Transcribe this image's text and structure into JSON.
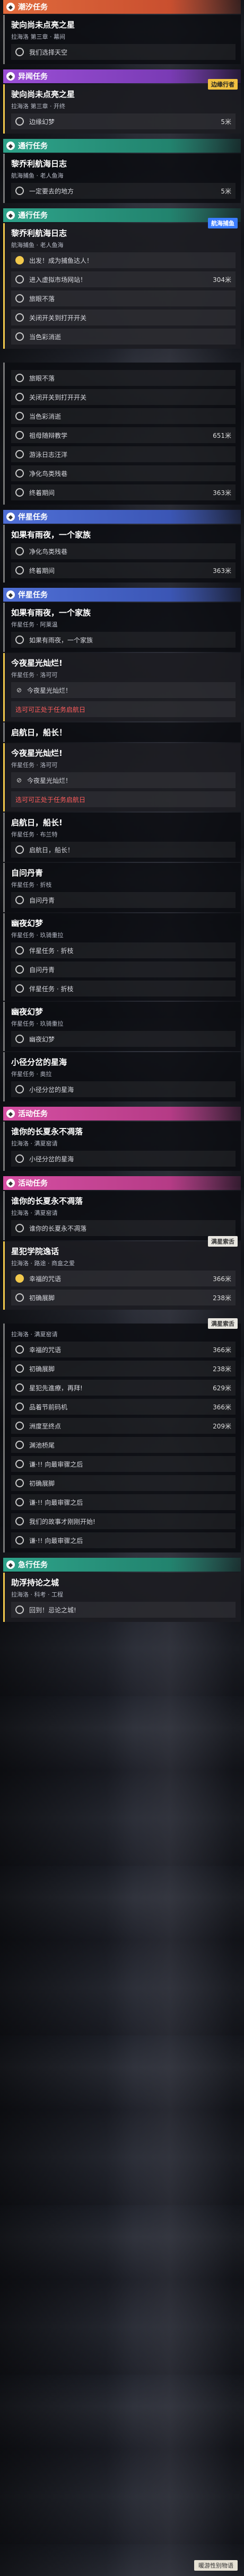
{
  "groups": [
    {
      "header": "潮汐任务",
      "color": "orange",
      "quests": [
        {
          "title": "驶向尚未点亮之星",
          "subtitle": "拉海洛 第三章 · 幕间",
          "active": false,
          "steps": [
            {
              "label": "我们选择天空",
              "distance": "",
              "done": false
            }
          ]
        }
      ]
    },
    {
      "header": "异闻任务",
      "color": "purple",
      "quests": [
        {
          "title": "驶向尚未点亮之星",
          "subtitle": "拉海洛 第三章 · 开终",
          "badge": "边缘行者",
          "active": true,
          "steps": [
            {
              "label": "边缘幻梦",
              "distance": "5米",
              "done": false
            }
          ]
        }
      ]
    },
    {
      "header": "通行任务",
      "color": "teal",
      "quests": [
        {
          "title": "黎乔利航海日志",
          "subtitle": "航海捕鱼 · 老人鱼海",
          "active": false,
          "steps": [
            {
              "label": "一定要去的地方",
              "distance": "5米",
              "done": false
            }
          ]
        }
      ]
    },
    {
      "header": "通行任务",
      "color": "teal",
      "quests": [
        {
          "title": "黎乔利航海日志",
          "subtitle": "航海捕鱼 · 老人鱼海",
          "badge": "航海捕鱼",
          "badgeStyle": "blue",
          "active": true,
          "steps": [
            {
              "label": "出发！成为捕鱼达人！",
              "distance": "",
              "done": true
            },
            {
              "label": "进入虚拟市场网站！",
              "distance": "304米",
              "done": false
            },
            {
              "label": "旅眼不落",
              "distance": "",
              "done": false
            },
            {
              "label": "关闭开关到打开开关",
              "distance": "",
              "done": false
            },
            {
              "label": "当色彩消逝",
              "distance": "",
              "done": false
            }
          ]
        }
      ]
    },
    {
      "header": "",
      "color": "",
      "quests": [
        {
          "title": "",
          "subtitle": "",
          "active": false,
          "steps": [
            {
              "label": "旅眼不落",
              "distance": "",
              "done": false
            },
            {
              "label": "关闭开关到打开开关",
              "distance": "",
              "done": false
            },
            {
              "label": "当色彩消逝",
              "distance": "",
              "done": false
            },
            {
              "label": "祖母随辩教学",
              "distance": "651米",
              "done": false
            },
            {
              "label": "游泳日志汪洋",
              "distance": "",
              "done": false
            },
            {
              "label": "净化鸟类残巷",
              "distance": "",
              "done": false
            },
            {
              "label": "终着期间",
              "distance": "363米",
              "done": false
            }
          ]
        }
      ]
    },
    {
      "header": "伴星任务",
      "color": "blue",
      "quests": [
        {
          "title": "如果有雨夜，一个家族",
          "subtitle": "",
          "active": false,
          "steps": [
            {
              "label": "净化鸟类残巷",
              "distance": "",
              "done": false
            },
            {
              "label": "终着期间",
              "distance": "363米",
              "done": false
            }
          ]
        }
      ]
    },
    {
      "header": "伴星任务",
      "color": "blue",
      "quests": [
        {
          "title": "如果有雨夜，一个家族",
          "subtitle": "伴星任务 · 阿莱温",
          "active": false,
          "steps": [
            {
              "label": "如果有雨夜，一个家族",
              "distance": "",
              "done": false
            }
          ]
        },
        {
          "title": "今夜星光灿烂!",
          "subtitle": "伴星任务 · 洛可可",
          "active": true,
          "steps": [
            {
              "label": "今夜星光灿烂！",
              "distance": "",
              "done": false,
              "icon": "forbidden"
            },
            {
              "label": "选可可正处于任务启航日",
              "distance": "",
              "done": false,
              "red": true
            }
          ]
        },
        {
          "title": "启航日，船长！",
          "subtitle": "",
          "active": false,
          "steps": []
        },
        {
          "title": "今夜星光灿烂!",
          "subtitle": "伴星任务 · 洛可可",
          "active": true,
          "steps": [
            {
              "label": "今夜星光灿烂！",
              "distance": "",
              "done": false,
              "icon": "forbidden"
            },
            {
              "label": "选可可正处于任务启航日",
              "distance": "",
              "done": false,
              "red": true
            }
          ]
        },
        {
          "title": "启航日，船长!",
          "subtitle": "伴星任务 · 布兰特",
          "active": false,
          "steps": [
            {
              "label": "启航日，船长！",
              "distance": "",
              "done": false
            }
          ]
        },
        {
          "title": "自问丹青",
          "subtitle": "伴星任务 · 折枝",
          "active": false,
          "steps": [
            {
              "label": "自问丹青",
              "distance": "",
              "done": false
            }
          ]
        },
        {
          "title": "幽夜幻梦",
          "subtitle": "伴星任务 · 玖骑重拉",
          "active": false,
          "steps": [
            {
              "label": "伴星任务 · 折枝",
              "distance": "",
              "done": false
            },
            {
              "label": "自问丹青",
              "distance": "",
              "done": false
            },
            {
              "label": "伴星任务 · 折枝",
              "distance": "",
              "done": false
            }
          ]
        },
        {
          "title": "幽夜幻梦",
          "subtitle": "伴星任务 · 玖骑重拉",
          "active": false,
          "steps": [
            {
              "label": "幽夜幻梦",
              "distance": "",
              "done": false
            }
          ]
        },
        {
          "title": "小径分岔的星海",
          "subtitle": "伴星任务 · 奥拉",
          "active": false,
          "steps": [
            {
              "label": "小径分岔的星海",
              "distance": "",
              "done": false
            }
          ]
        }
      ]
    },
    {
      "header": "活动任务",
      "color": "pink",
      "quests": [
        {
          "title": "谁你的长夏永不凋落",
          "subtitle": "拉海洛 · 满夏窑请",
          "active": false,
          "steps": [
            {
              "label": "小径分岔的星海",
              "distance": "",
              "done": false
            }
          ]
        }
      ]
    },
    {
      "header": "活动任务",
      "color": "pink",
      "quests": [
        {
          "title": "谁你的长夏永不凋落",
          "subtitle": "拉海洛 · 满夏窑请",
          "active": false,
          "steps": [
            {
              "label": "谁你的长夏永不凋落",
              "distance": "",
              "done": false
            }
          ]
        },
        {
          "title": "星犯学院逸话",
          "subtitle": "拉海洛 · 路途 · 商盒之爱",
          "badge": "满星索舌",
          "badgeStyle": "white",
          "active": true,
          "steps": [
            {
              "label": "幸福的咒语",
              "distance": "366米",
              "done": true
            },
            {
              "label": "初确展脚",
              "distance": "238米",
              "done": false
            }
          ]
        }
      ]
    },
    {
      "header": "",
      "color": "",
      "quests": [
        {
          "title": "",
          "subtitle": "拉海洛 · 满夏窑请",
          "badge": "满星索舌",
          "badgeStyle": "white",
          "active": false,
          "steps": [
            {
              "label": "幸福的咒语",
              "distance": "366米",
              "done": false
            },
            {
              "label": "初确展脚",
              "distance": "238米",
              "done": false
            },
            {
              "label": "星犯先進療，再拜!",
              "distance": "629米",
              "done": false
            },
            {
              "label": "品着节前码机",
              "distance": "366米",
              "done": false
            },
            {
              "label": "洲度至终点",
              "distance": "209米",
              "done": false
            },
            {
              "label": "渊池桥尾",
              "distance": "",
              "done": false
            },
            {
              "label": "谦·!! 向最审骤之后",
              "distance": "",
              "done": false
            },
            {
              "label": "初确展脚",
              "distance": "",
              "done": false
            },
            {
              "label": "谦·!! 向最审骤之后",
              "distance": "",
              "done": false
            },
            {
              "label": "我们的故事才刚刚开始!",
              "distance": "",
              "done": false
            },
            {
              "label": "谦·!! 向最审骤之后",
              "distance": "",
              "done": false
            }
          ]
        }
      ]
    },
    {
      "header": "急行任务",
      "color": "teal",
      "quests": [
        {
          "title": "助浮持论之城",
          "subtitle": "拉海洛 · 科考 · 工程",
          "active": true,
          "steps": [
            {
              "label": "回到！忌论之城!",
              "distance": "",
              "done": false
            }
          ]
        }
      ]
    }
  ],
  "footer": {
    "tag": "暖游性别物语"
  }
}
